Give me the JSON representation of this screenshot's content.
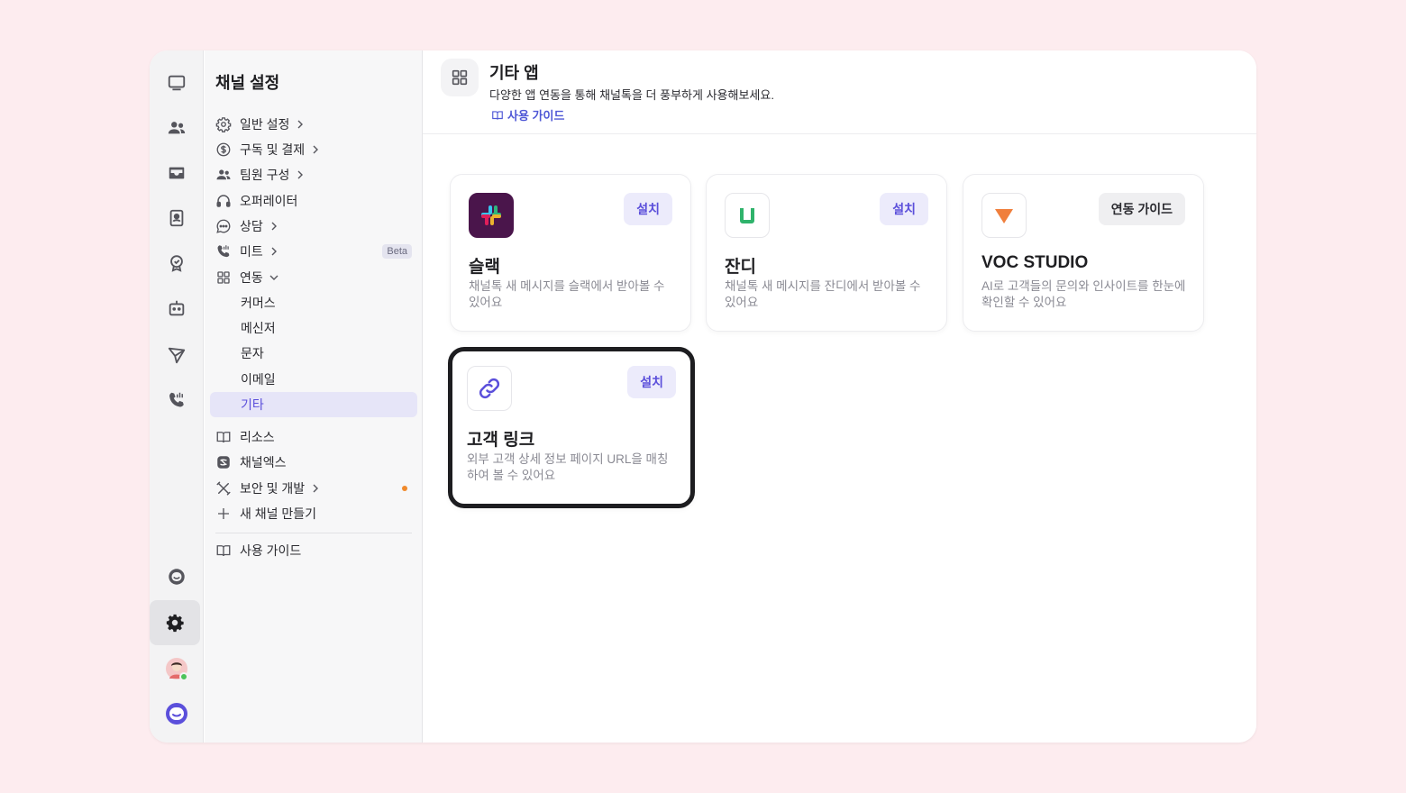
{
  "sidebar": {
    "title": "채널 설정",
    "items": [
      {
        "label": "일반 설정"
      },
      {
        "label": "구독 및 결제"
      },
      {
        "label": "팀원 구성"
      },
      {
        "label": "오퍼레이터"
      },
      {
        "label": "상담"
      },
      {
        "label": "미트",
        "badge": "Beta"
      },
      {
        "label": "연동"
      },
      {
        "label": "커머스"
      },
      {
        "label": "메신저"
      },
      {
        "label": "문자"
      },
      {
        "label": "이메일"
      },
      {
        "label": "기타"
      },
      {
        "label": "리소스"
      },
      {
        "label": "채널엑스"
      },
      {
        "label": "보안 및 개발"
      },
      {
        "label": "새 채널 만들기"
      },
      {
        "label": "사용 가이드"
      }
    ]
  },
  "header": {
    "title": "기타 앱",
    "description": "다양한 앱 연동을 통해 채널톡을 더 풍부하게 사용해보세요.",
    "guide_link": "사용 가이드"
  },
  "cards": [
    {
      "title": "슬랙",
      "description": "채널톡 새 메시지를 슬랙에서 받아볼 수 있어요",
      "button": "설치",
      "icon": "slack-logo-icon"
    },
    {
      "title": "잔디",
      "description": "채널톡 새 메시지를 잔디에서 받아볼 수 있어요",
      "button": "설치",
      "icon": "jandi-logo-icon"
    },
    {
      "title": "VOC STUDIO",
      "description": "AI로 고객들의 문의와 인사이트를 한눈에 확인할 수 있어요",
      "button": "연동 가이드",
      "icon": "voc-studio-logo-icon"
    },
    {
      "title": "고객 링크",
      "description": "외부 고객 상세 정보 페이지 URL을 매칭하여 볼 수 있어요",
      "button": "설치",
      "icon": "link-icon"
    }
  ],
  "colors": {
    "accent": "#5b4fdb",
    "page_background": "#fdecef",
    "notification_dot": "#f08a2c",
    "online_status": "#4cc35a"
  }
}
